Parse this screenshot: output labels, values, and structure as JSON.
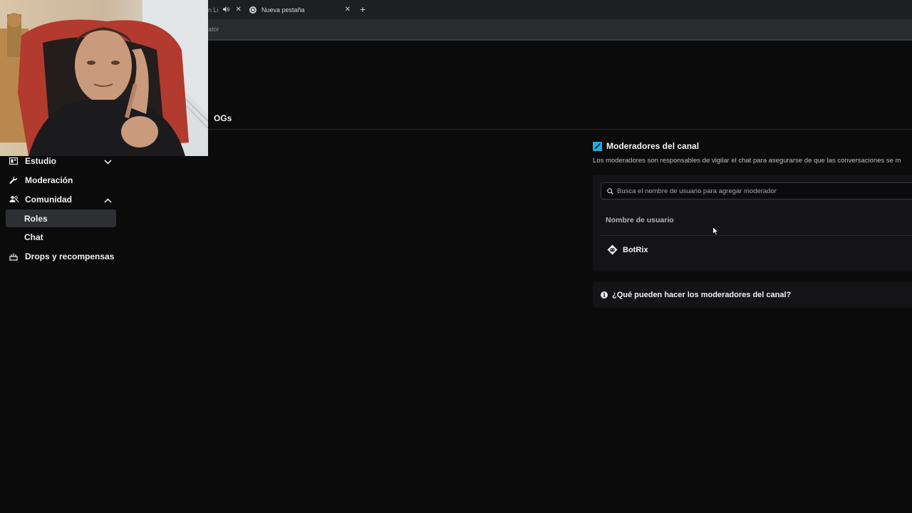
{
  "browser": {
    "tabs": [
      {
        "label": "n Li",
        "audio_icon": "speaker-icon"
      },
      {
        "label": "Nueva pestaña",
        "icon": "chrome-icon"
      }
    ],
    "address_fragment": "ator"
  },
  "header": {
    "tab_fragment": "OGs"
  },
  "sidebar": {
    "items": [
      {
        "label": "Estudio",
        "icon": "studio-icon",
        "expand": "chevron-down-icon"
      },
      {
        "label": "Moderación",
        "icon": "wrench-icon"
      },
      {
        "label": "Comunidad",
        "icon": "community-icon",
        "expand": "chevron-up-icon"
      },
      {
        "label": "Roles",
        "active": true
      },
      {
        "label": "Chat"
      },
      {
        "label": "Drops y recompensas",
        "icon": "drops-icon"
      }
    ]
  },
  "moderators": {
    "title": "Moderadores del canal",
    "description": "Los moderadores son responsables de vigilar el chat para asegurarse de que las conversaciones se m",
    "search_placeholder": "Busca el nombre de usuario para agregar moderador",
    "column_header": "Nombre de usuario",
    "rows": [
      {
        "username": "BotRix"
      }
    ],
    "faq": "¿Qué pueden hacer los moderadores del canal?"
  },
  "colors": {
    "accent": "#2aa7e0",
    "background": "#0b0b0c",
    "panel": "#141416"
  }
}
